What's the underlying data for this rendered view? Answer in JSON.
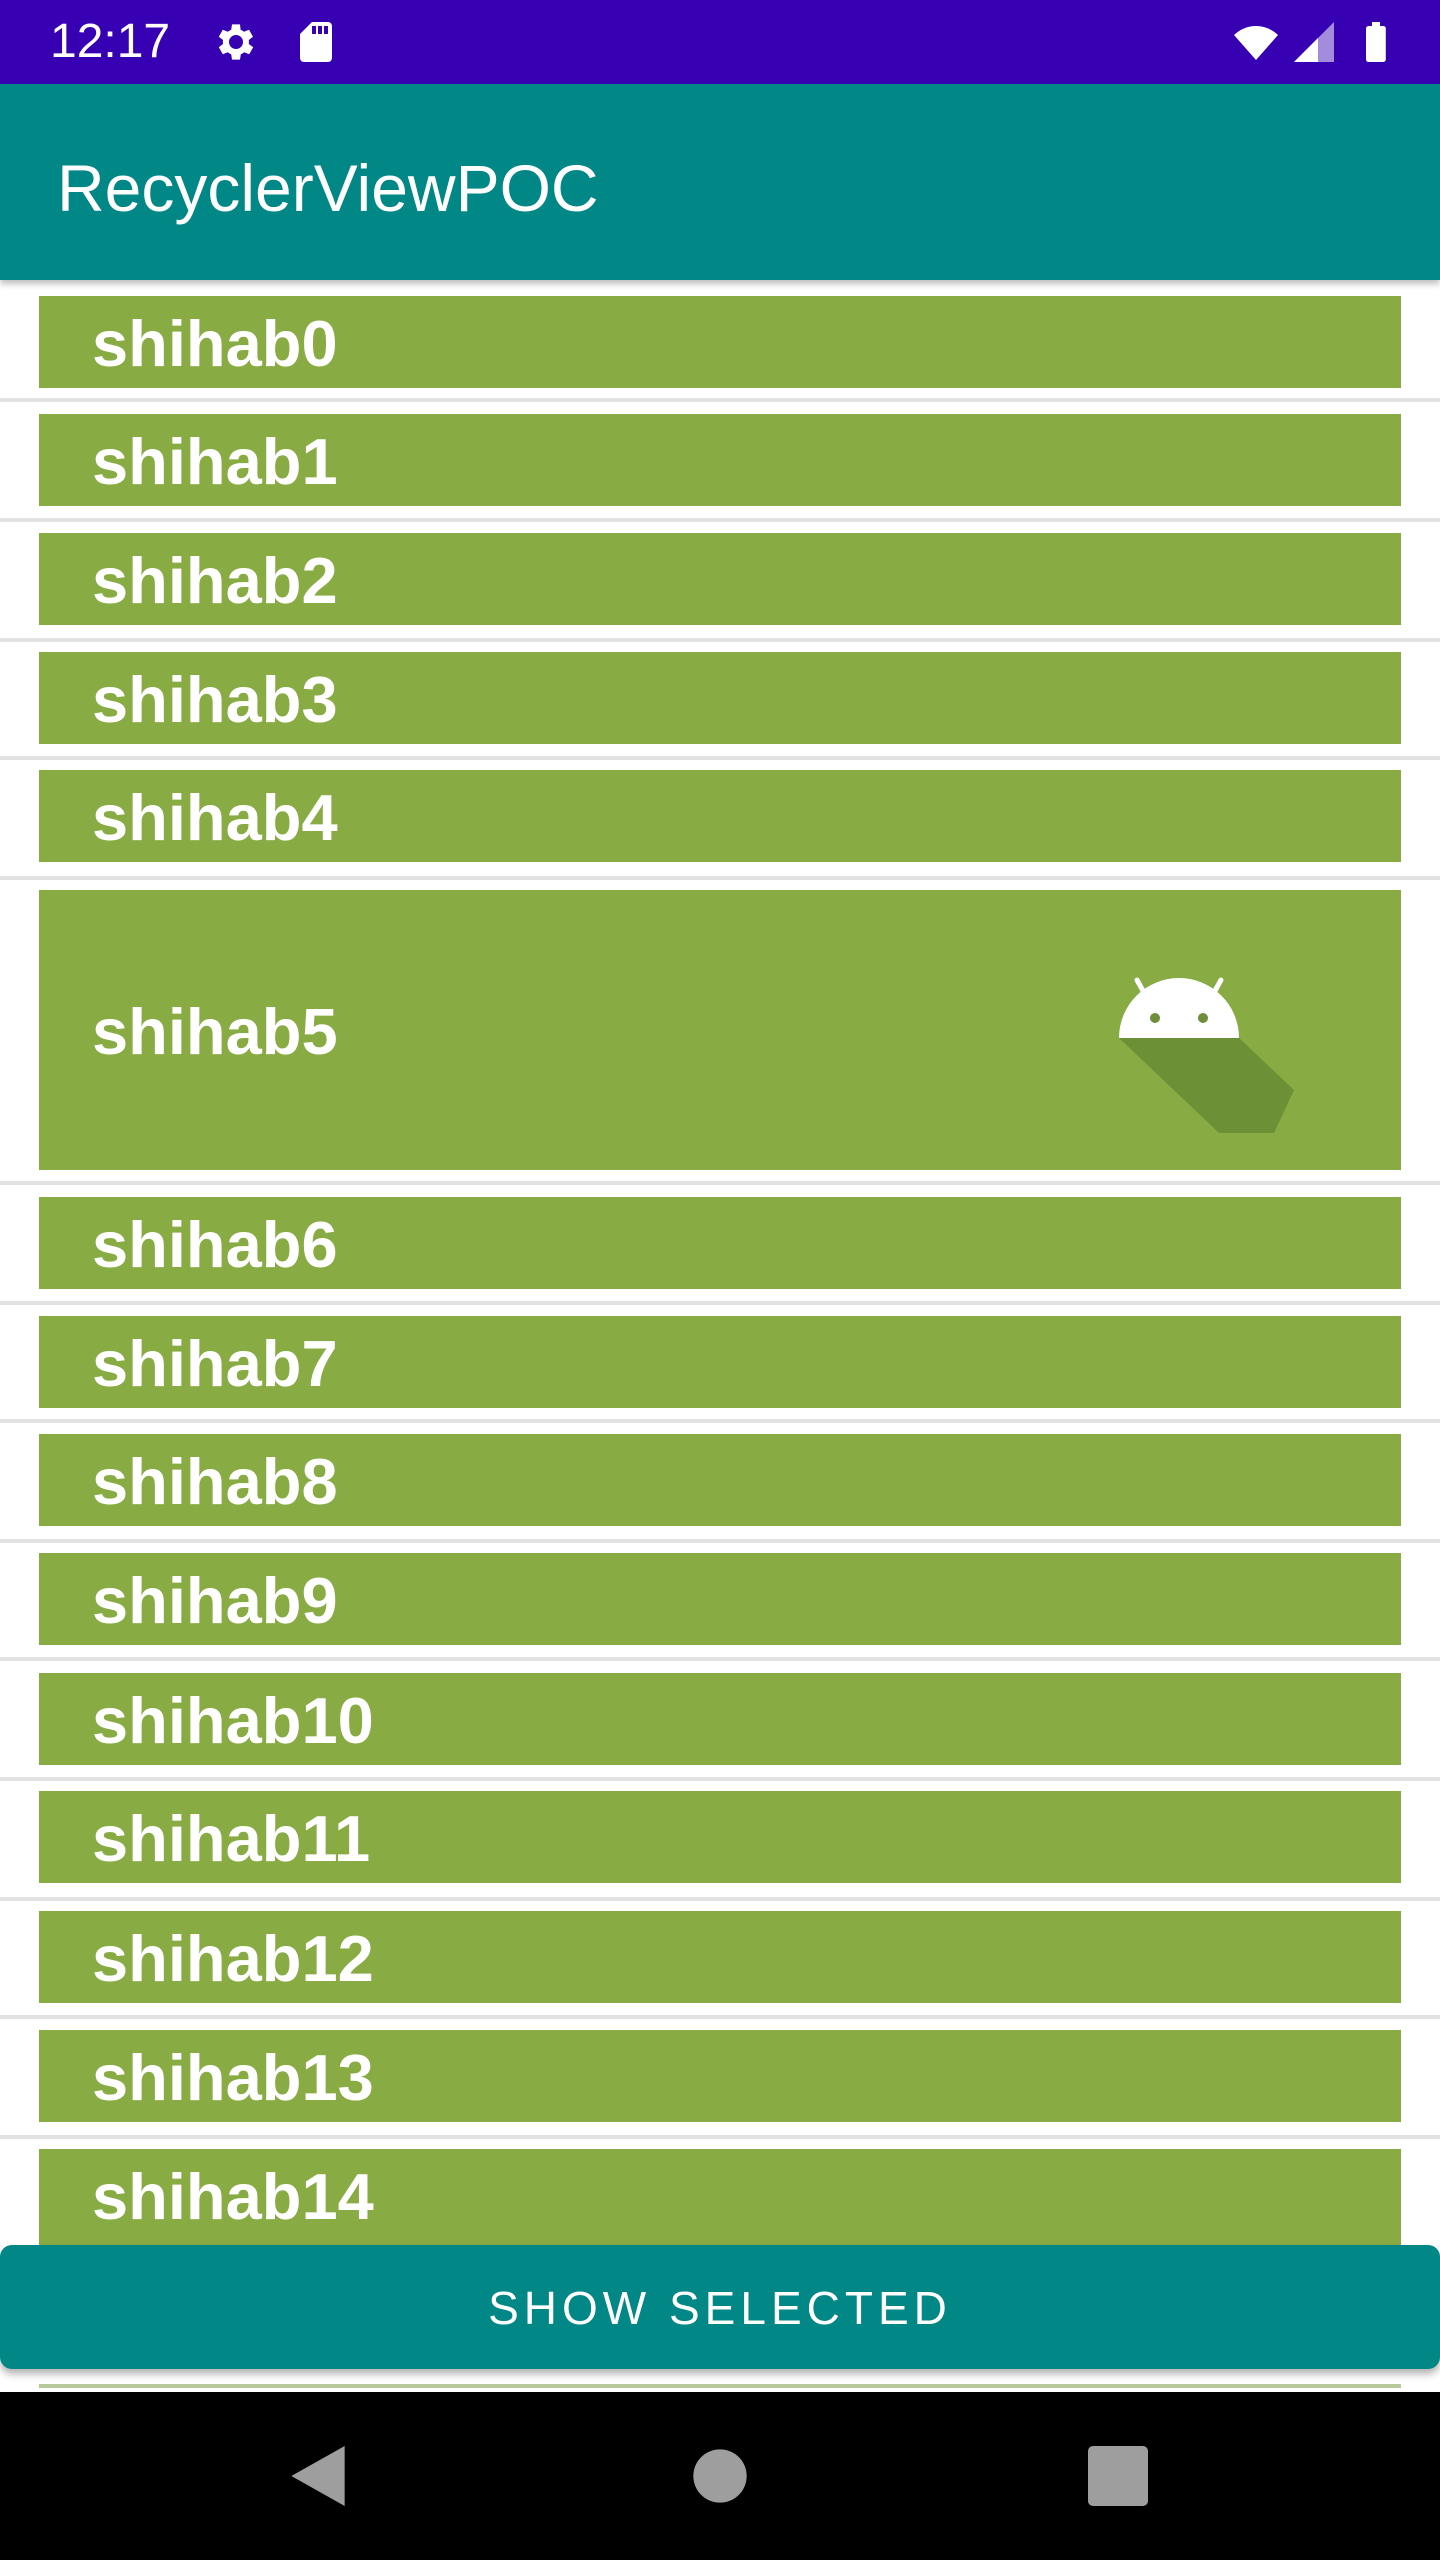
{
  "status_bar": {
    "time": "12:17",
    "icons": [
      "gear-icon",
      "sd-card-icon",
      "wifi-icon",
      "cell-signal-icon",
      "battery-icon"
    ],
    "background": "#3700b3"
  },
  "app_bar": {
    "title": "RecyclerViewPOC",
    "background": "#018786"
  },
  "list": {
    "card_color": "#88ab43",
    "items": [
      {
        "label": "shihab0"
      },
      {
        "label": "shihab1"
      },
      {
        "label": "shihab2"
      },
      {
        "label": "shihab3"
      },
      {
        "label": "shihab4"
      },
      {
        "label": "shihab5",
        "icon": "android-icon"
      },
      {
        "label": "shihab6"
      },
      {
        "label": "shihab7"
      },
      {
        "label": "shihab8"
      },
      {
        "label": "shihab9"
      },
      {
        "label": "shihab10"
      },
      {
        "label": "shihab11"
      },
      {
        "label": "shihab12"
      },
      {
        "label": "shihab13"
      },
      {
        "label": "shihab14"
      }
    ]
  },
  "show_selected_button": {
    "label": "SHOW SELECTED"
  },
  "nav_bar": {
    "buttons": [
      "back-icon",
      "home-icon",
      "recents-icon"
    ]
  }
}
